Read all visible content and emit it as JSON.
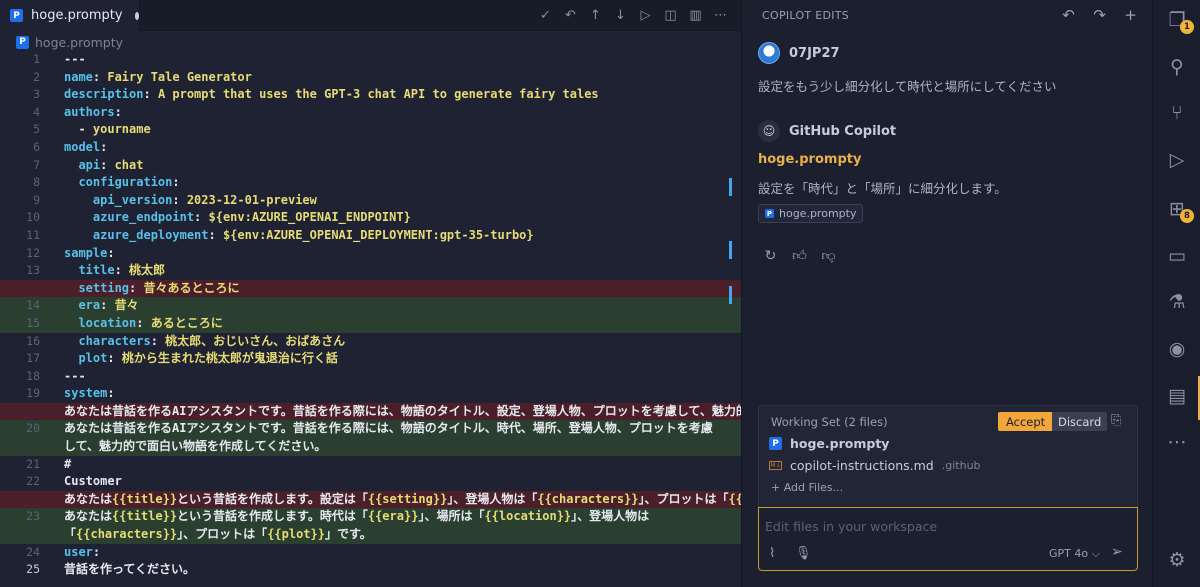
{
  "editor": {
    "tab_label": "hoge.prompty",
    "breadcrumb": "hoge.prompty",
    "lines": [
      {
        "num": "1",
        "kind": "normal",
        "parts": [
          [
            "br",
            "---"
          ]
        ]
      },
      {
        "num": "2",
        "kind": "normal",
        "parts": [
          [
            "k",
            "name"
          ],
          [
            "br",
            ": "
          ],
          [
            "v",
            "Fairy Tale Generator"
          ]
        ]
      },
      {
        "num": "3",
        "kind": "normal",
        "parts": [
          [
            "k",
            "description"
          ],
          [
            "br",
            ": "
          ],
          [
            "v",
            "A prompt that uses the GPT-3 chat API to generate fairy tales"
          ]
        ]
      },
      {
        "num": "4",
        "kind": "normal",
        "parts": [
          [
            "k",
            "authors"
          ],
          [
            "br",
            ":"
          ]
        ]
      },
      {
        "num": "5",
        "kind": "normal",
        "parts": [
          [
            "br",
            "  - "
          ],
          [
            "v",
            "yourname"
          ]
        ]
      },
      {
        "num": "6",
        "kind": "normal",
        "parts": [
          [
            "k",
            "model"
          ],
          [
            "br",
            ":"
          ]
        ]
      },
      {
        "num": "7",
        "kind": "normal",
        "parts": [
          [
            "k",
            "  api"
          ],
          [
            "br",
            ": "
          ],
          [
            "v",
            "chat"
          ]
        ]
      },
      {
        "num": "8",
        "kind": "normal",
        "parts": [
          [
            "k",
            "  configuration"
          ],
          [
            "br",
            ":"
          ]
        ]
      },
      {
        "num": "9",
        "kind": "normal",
        "parts": [
          [
            "k",
            "    api_version"
          ],
          [
            "br",
            ": "
          ],
          [
            "v",
            "2023-12-01-preview"
          ]
        ]
      },
      {
        "num": "10",
        "kind": "normal",
        "parts": [
          [
            "k",
            "    azure_endpoint"
          ],
          [
            "br",
            ": "
          ],
          [
            "v",
            "${env:AZURE_OPENAI_ENDPOINT}"
          ]
        ]
      },
      {
        "num": "11",
        "kind": "normal",
        "parts": [
          [
            "k",
            "    azure_deployment"
          ],
          [
            "br",
            ": "
          ],
          [
            "v",
            "${env:AZURE_OPENAI_DEPLOYMENT:gpt-35-turbo}"
          ]
        ]
      },
      {
        "num": "12",
        "kind": "normal",
        "parts": [
          [
            "k",
            "sample"
          ],
          [
            "br",
            ":"
          ]
        ]
      },
      {
        "num": "13",
        "kind": "normal",
        "parts": [
          [
            "k",
            "  title"
          ],
          [
            "br",
            ": "
          ],
          [
            "v",
            "桃太郎"
          ]
        ]
      },
      {
        "num": "",
        "kind": "del",
        "parts": [
          [
            "k",
            "  setting"
          ],
          [
            "br",
            ": "
          ],
          [
            "v",
            "昔々あるところに"
          ]
        ]
      },
      {
        "num": "14",
        "kind": "ins",
        "parts": [
          [
            "k",
            "  era"
          ],
          [
            "br",
            ": "
          ],
          [
            "v",
            "昔々"
          ]
        ]
      },
      {
        "num": "15",
        "kind": "ins",
        "parts": [
          [
            "k",
            "  location"
          ],
          [
            "br",
            ": "
          ],
          [
            "v",
            "あるところに"
          ]
        ]
      },
      {
        "num": "16",
        "kind": "normal",
        "parts": [
          [
            "k",
            "  characters"
          ],
          [
            "br",
            ": "
          ],
          [
            "v",
            "桃太郎、おじいさん、おばあさん"
          ]
        ]
      },
      {
        "num": "17",
        "kind": "normal",
        "parts": [
          [
            "k",
            "  plot"
          ],
          [
            "br",
            ": "
          ],
          [
            "v",
            "桃から生まれた桃太郎が鬼退治に行く話"
          ]
        ]
      },
      {
        "num": "18",
        "kind": "normal",
        "parts": [
          [
            "br",
            "---"
          ]
        ]
      },
      {
        "num": "19",
        "kind": "normal",
        "parts": [
          [
            "k",
            "system"
          ],
          [
            "br",
            ":"
          ]
        ]
      },
      {
        "num": "",
        "kind": "del",
        "parts": [
          [
            "br",
            "あなたは昔話を作るAIアシスタントです。昔話を作る際には、物語のタイトル、設定、登場人物、プロットを考慮して、魅力的で"
          ]
        ]
      },
      {
        "num": "20",
        "kind": "ins",
        "tall": true,
        "parts": [
          [
            "br",
            "あなたは昔話を作るAIアシスタントです。昔話を作る際には、物語のタイトル、時代、場所、登場人物、プロットを考慮して、魅力的で面白い物語を作成してください。"
          ]
        ]
      },
      {
        "num": "21",
        "kind": "normal",
        "parts": [
          [
            "br",
            "#"
          ]
        ]
      },
      {
        "num": "22",
        "kind": "normal",
        "parts": [
          [
            "br",
            "Customer"
          ]
        ]
      },
      {
        "num": "",
        "kind": "del",
        "parts": [
          [
            "br",
            "あなたは"
          ],
          [
            "v",
            "{{title}}"
          ],
          [
            "br",
            "という昔話を作成します。設定は「"
          ],
          [
            "v",
            "{{setting}}"
          ],
          [
            "br",
            "」、登場人物は「"
          ],
          [
            "v",
            "{{characters}}"
          ],
          [
            "br",
            "」、プロットは「"
          ],
          [
            "v",
            "{{"
          ]
        ]
      },
      {
        "num": "23",
        "kind": "ins",
        "tall": true,
        "parts": [
          [
            "br",
            "あなたは"
          ],
          [
            "v",
            "{{title}}"
          ],
          [
            "br",
            "という昔話を作成します。時代は「"
          ],
          [
            "v",
            "{{era}}"
          ],
          [
            "br",
            "」、場所は「"
          ],
          [
            "v",
            "{{location}}"
          ],
          [
            "br",
            "」、登場人物は「"
          ],
          [
            "v",
            "{{characters}}"
          ],
          [
            "br",
            "」、プロットは「"
          ],
          [
            "v",
            "{{plot}}"
          ],
          [
            "br",
            "」です。"
          ]
        ]
      },
      {
        "num": "24",
        "kind": "normal",
        "parts": [
          [
            "k",
            "user"
          ],
          [
            "br",
            ":"
          ]
        ]
      },
      {
        "num": "25",
        "kind": "cur",
        "parts": [
          [
            "br",
            "昔話を作ってください。"
          ]
        ]
      }
    ]
  },
  "chat": {
    "title": "COPILOT EDITS",
    "user_name": "07JP27",
    "user_message": "設定をもう少し細分化して時代と場所にしてください",
    "copilot_name": "GitHub Copilot",
    "response_file": "hoge.prompty",
    "response_text": "設定を「時代」と「場所」に細分化します。",
    "file_chip": "hoge.prompty",
    "working_set": {
      "title": "Working Set (2 files)",
      "accept": "Accept",
      "discard": "Discard",
      "files": [
        {
          "name": "hoge.prompty",
          "sub": ""
        },
        {
          "name": "copilot-instructions.md",
          "sub": ".github"
        }
      ],
      "add_files": "+ Add Files..."
    },
    "input_placeholder": "Edit files in your workspace",
    "model": "GPT 4o ⌵"
  },
  "activity": {
    "explorer_badge": "1",
    "extensions_badge": "8"
  },
  "colors": {
    "accent": "#f3a73a",
    "deleted_line": "#4a1f2a",
    "inserted_line": "#2a3f30",
    "key": "#57c1e8",
    "value": "#e6db74"
  }
}
